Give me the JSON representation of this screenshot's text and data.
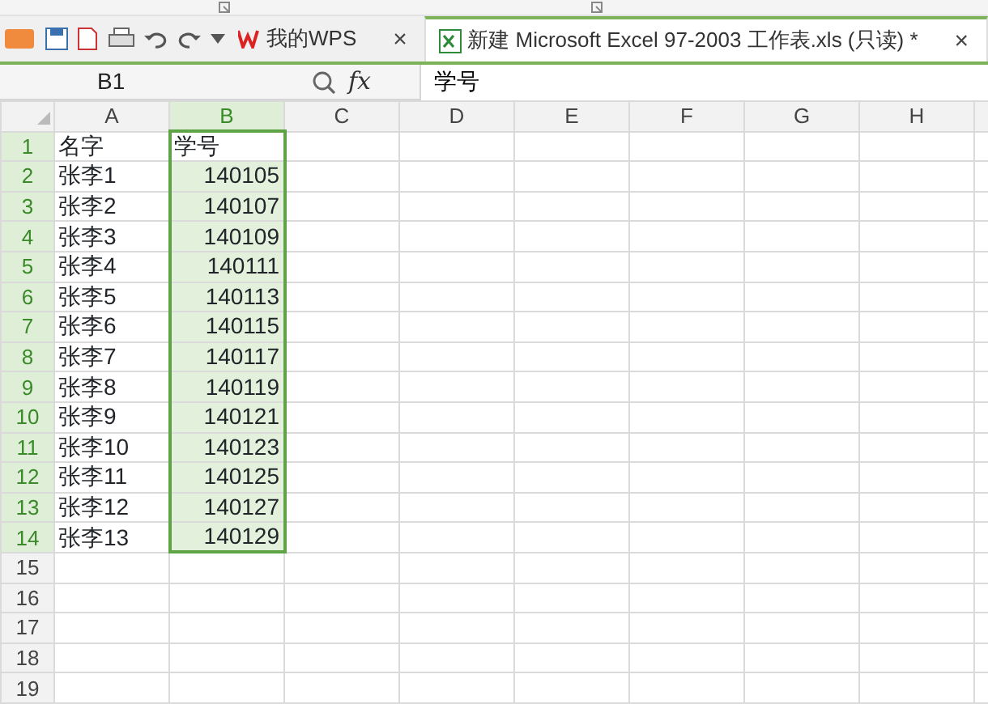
{
  "tabs": [
    {
      "label": "我的WPS",
      "selected": false,
      "close": "×"
    },
    {
      "label": "新建 Microsoft Excel 97-2003 工作表.xls (只读) *",
      "selected": true,
      "close": "×"
    }
  ],
  "formula_bar": {
    "name_box": "B1",
    "function_label": "fx",
    "value": "学号"
  },
  "columns": [
    {
      "label": "A",
      "selected": false,
      "numeric": false
    },
    {
      "label": "B",
      "selected": true,
      "numeric": true
    },
    {
      "label": "C",
      "selected": false
    },
    {
      "label": "D",
      "selected": false
    },
    {
      "label": "E",
      "selected": false
    },
    {
      "label": "F",
      "selected": false
    },
    {
      "label": "G",
      "selected": false
    },
    {
      "label": "H",
      "selected": false
    }
  ],
  "rows": [
    {
      "number": "1",
      "selected": true,
      "kind": "heading",
      "cells": [
        "名字",
        "学号"
      ]
    },
    {
      "number": "2",
      "selected": true,
      "kind": "data",
      "cells": [
        "张李1",
        "140105"
      ]
    },
    {
      "number": "3",
      "selected": true,
      "kind": "data",
      "cells": [
        "张李2",
        "140107"
      ]
    },
    {
      "number": "4",
      "selected": true,
      "kind": "data",
      "cells": [
        "张李3",
        "140109"
      ]
    },
    {
      "number": "5",
      "selected": true,
      "kind": "data",
      "cells": [
        "张李4",
        "140111"
      ]
    },
    {
      "number": "6",
      "selected": true,
      "kind": "data",
      "cells": [
        "张李5",
        "140113"
      ]
    },
    {
      "number": "7",
      "selected": true,
      "kind": "data",
      "cells": [
        "张李6",
        "140115"
      ]
    },
    {
      "number": "8",
      "selected": true,
      "kind": "data",
      "cells": [
        "张李7",
        "140117"
      ]
    },
    {
      "number": "9",
      "selected": true,
      "kind": "data",
      "cells": [
        "张李8",
        "140119"
      ]
    },
    {
      "number": "10",
      "selected": true,
      "kind": "data",
      "cells": [
        "张李9",
        "140121"
      ]
    },
    {
      "number": "11",
      "selected": true,
      "kind": "data",
      "cells": [
        "张李10",
        "140123"
      ]
    },
    {
      "number": "12",
      "selected": true,
      "kind": "data",
      "cells": [
        "张李11",
        "140125"
      ]
    },
    {
      "number": "13",
      "selected": true,
      "kind": "data",
      "cells": [
        "张李12",
        "140127"
      ]
    },
    {
      "number": "14",
      "selected": true,
      "kind": "data",
      "cells": [
        "张李13",
        "140129"
      ]
    },
    {
      "number": "15",
      "selected": false,
      "cells": []
    },
    {
      "number": "16",
      "selected": false,
      "cells": []
    },
    {
      "number": "17",
      "selected": false,
      "cells": []
    },
    {
      "number": "18",
      "selected": false,
      "cells": []
    },
    {
      "number": "19",
      "selected": false,
      "cells": []
    }
  ]
}
